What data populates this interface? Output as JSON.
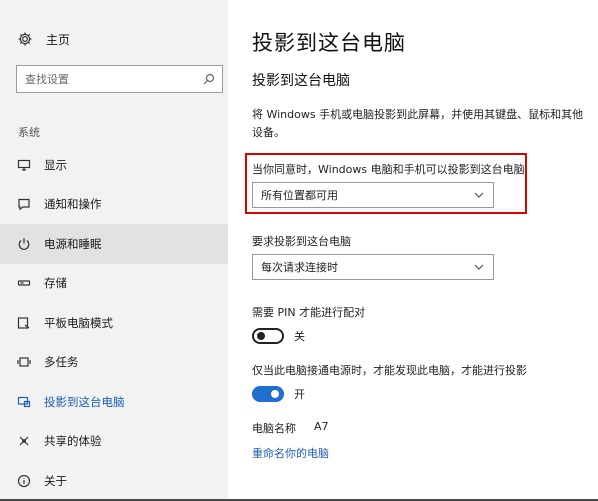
{
  "sidebar": {
    "home_label": "主页",
    "search_placeholder": "查找设置",
    "section_label": "系统",
    "items": [
      {
        "label": "显示",
        "icon": "monitor-icon"
      },
      {
        "label": "通知和操作",
        "icon": "message-icon"
      },
      {
        "label": "电源和睡眠",
        "icon": "power-icon"
      },
      {
        "label": "存储",
        "icon": "storage-icon"
      },
      {
        "label": "平板电脑模式",
        "icon": "tablet-icon"
      },
      {
        "label": "多任务",
        "icon": "multitask-icon"
      },
      {
        "label": "投影到这台电脑",
        "icon": "project-icon"
      },
      {
        "label": "共享的体验",
        "icon": "share-icon"
      },
      {
        "label": "关于",
        "icon": "info-icon"
      }
    ]
  },
  "main": {
    "title": "投影到这台电脑",
    "subtitle": "投影到这台电脑",
    "description": "将 Windows 手机或电脑投影到此屏幕，并使用其键盘、鼠标和其他设备。",
    "availability_label": "当你同意时，Windows 电脑和手机可以投影到这台电脑",
    "availability_value": "所有位置都可用",
    "ask_label": "要求投影到这台电脑",
    "ask_value": "每次请求连接时",
    "pin_label": "需要 PIN 才能进行配对",
    "pin_state": "关",
    "power_label": "仅当此电脑接通电源时，才能发现此电脑，才能进行投影",
    "power_state": "开",
    "pc_name_label": "电脑名称",
    "pc_name_value": "A7",
    "rename_link": "重命名你的电脑"
  },
  "colors": {
    "accent": "#1f6fd0",
    "link": "#1f5fb3",
    "highlight_border": "#d90000",
    "sidebar_bg": "#f2f2f2"
  }
}
